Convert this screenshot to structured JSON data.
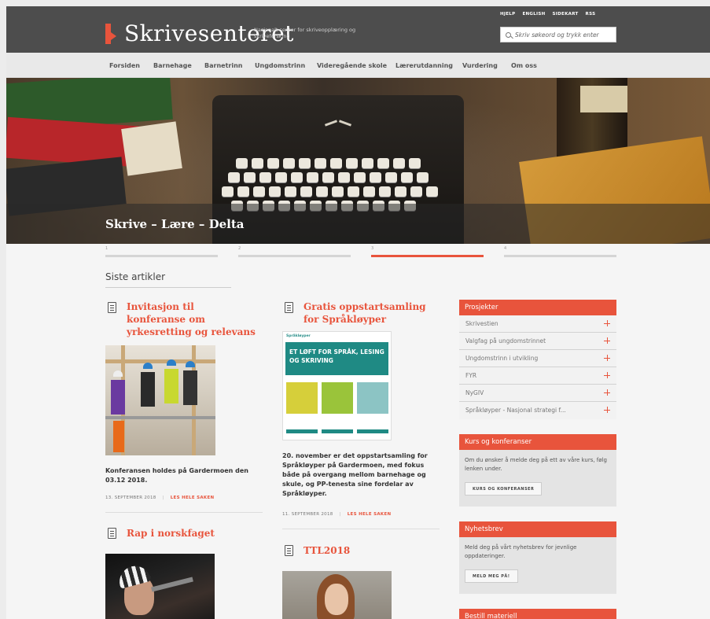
{
  "header": {
    "logo_prefix": "Skrive",
    "logo_suffix": "senteret",
    "tagline": "Nasjonalt senter for skriveopplæring og skriveforsking",
    "top_links": [
      "HJELP",
      "ENGLISH",
      "SIDEKART",
      "RSS"
    ],
    "search_placeholder": "Skriv søkeord og trykk enter"
  },
  "nav": {
    "items": [
      "Forsiden",
      "Barnehage",
      "Barnetrinn",
      "Ungdomstrinn",
      "Videregående skole",
      "Lærerutdanning",
      "Vurdering",
      "Om oss"
    ]
  },
  "hero": {
    "title": "Skrive – Lære – Delta",
    "slider_tabs": [
      "1",
      "2",
      "3",
      "4"
    ],
    "active_tab": 2
  },
  "main": {
    "section_title": "Siste artikler",
    "articles": [
      {
        "title": "Invitasjon til konferanse om yrkesretting og relevans",
        "desc": "Konferansen holdes på Gardermoen den 03.12 2018.",
        "date": "13. SEPTEMBER 2018",
        "more": "LES HELE SAKEN"
      },
      {
        "title": "Gratis oppstartsamling for Språkløyper",
        "desc": "20. november er det oppstartsamling for Språkløyper på Gardermoen, med fokus både på overgang mellom barnehage og skule, og PP-tenesta sine fordelar av Språkløyper.",
        "date": "11. SEPTEMBER 2018",
        "more": "LES HELE SAKEN",
        "image_logo": "Språkløyper",
        "image_banner": "ET LØFT FOR SPRÅK, LESING OG SKRIVING"
      },
      {
        "title": "Rap i norskfaget"
      },
      {
        "title": "TTL2018"
      }
    ]
  },
  "sidebar": {
    "projects": {
      "heading": "Prosjekter",
      "items": [
        "Skrivestien",
        "Valgfag på ungdomstrinnet",
        "Ungdomstrinn i utvikling",
        "FYR",
        "NyGIV",
        "Språkløyper - Nasjonal strategi f..."
      ]
    },
    "courses": {
      "heading": "Kurs og konferanser",
      "text": "Om du ønsker å melde deg på ett av våre kurs, følg lenken under.",
      "button": "KURS OG KONFERANSER"
    },
    "newsletter": {
      "heading": "Nyhetsbrev",
      "text": "Meld deg på vårt nyhetsbrev for jevnlige oppdateringer.",
      "button": "MELD MEG PÅ!"
    },
    "order": {
      "heading": "Bestill materiell"
    }
  },
  "colors": {
    "accent": "#e8543c",
    "header_bg": "#4d4d4d",
    "teal": "#1f8a84"
  }
}
